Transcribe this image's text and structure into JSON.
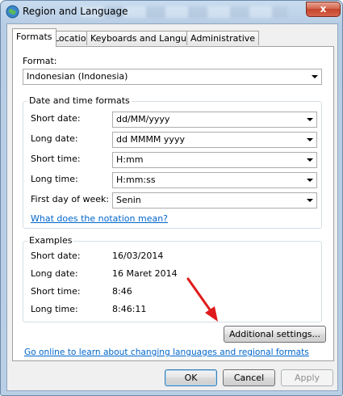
{
  "window": {
    "title": "Region and Language",
    "close_label": "x"
  },
  "tabs": [
    {
      "label": "Formats",
      "active": true
    },
    {
      "label": "Location",
      "active": false
    },
    {
      "label": "Keyboards and Languages",
      "active": false
    },
    {
      "label": "Administrative",
      "active": false
    }
  ],
  "formats": {
    "format_label": "Format:",
    "format_value": "Indonesian (Indonesia)",
    "datetime_group_title": "Date and time formats",
    "fields": [
      {
        "label": "Short date:",
        "value": "dd/MM/yyyy"
      },
      {
        "label": "Long date:",
        "value": "dd MMMM yyyy"
      },
      {
        "label": "Short time:",
        "value": "H:mm"
      },
      {
        "label": "Long time:",
        "value": "H:mm:ss"
      },
      {
        "label": "First day of week:",
        "value": "Senin"
      }
    ],
    "notation_link": "What does the notation mean?",
    "examples_group_title": "Examples",
    "examples": [
      {
        "label": "Short date:",
        "value": "16/03/2014"
      },
      {
        "label": "Long date:",
        "value": "16 Maret 2014"
      },
      {
        "label": "Short time:",
        "value": "8:46"
      },
      {
        "label": "Long time:",
        "value": "8:46:11"
      }
    ],
    "additional_settings_label": "Additional settings...",
    "online_link": "Go online to learn about changing languages and regional formats"
  },
  "buttons": {
    "ok": "OK",
    "cancel": "Cancel",
    "apply": "Apply"
  },
  "colors": {
    "link": "#0066cc",
    "annotation_arrow": "#e01b1b"
  }
}
